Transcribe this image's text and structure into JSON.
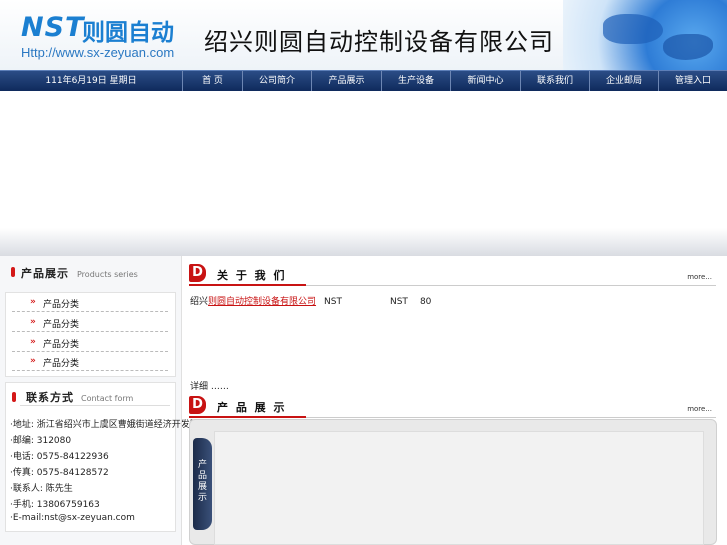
{
  "header": {
    "logo_nst": "NST",
    "logo_cn": "则圆自动",
    "logo_url": "Http://www.sx-zeyuan.com",
    "company": "绍兴则圆自动控制设备有限公司"
  },
  "nav": {
    "date": "111年6月19日 星期日",
    "items": [
      "首  页",
      "公司简介",
      "产品展示",
      "生产设备",
      "新闻中心",
      "联系我们",
      "企业邮局",
      "管理入口"
    ]
  },
  "left": {
    "products_title_cn": "产品展示",
    "products_title_en": "Products series",
    "product_items": [
      "产品分类",
      "产品分类",
      "产品分类",
      "产品分类"
    ],
    "contact_title_cn": "联系方式",
    "contact_title_en": "Contact form",
    "contact_lines": [
      "·地址: 浙江省绍兴市上虞区曹娥街道经济开发区",
      "·邮编: 312080",
      "·电话: 0575-84122936",
      "·传真: 0575-84128572",
      "·联系人: 陈先生",
      "·手机: 13806759163",
      "·E-mail:nst@sx-zeyuan.com"
    ]
  },
  "about": {
    "title": "关 于 我 们",
    "more": "more...",
    "lead": "绍兴",
    "link": "则圆自动控制设备有限公司",
    "text1": "NST",
    "text2": "NST",
    "text3": "80",
    "more_line": "详细 ……"
  },
  "products": {
    "title": "产 品 展 示",
    "more": "more...",
    "side_tab": "产品展示"
  }
}
